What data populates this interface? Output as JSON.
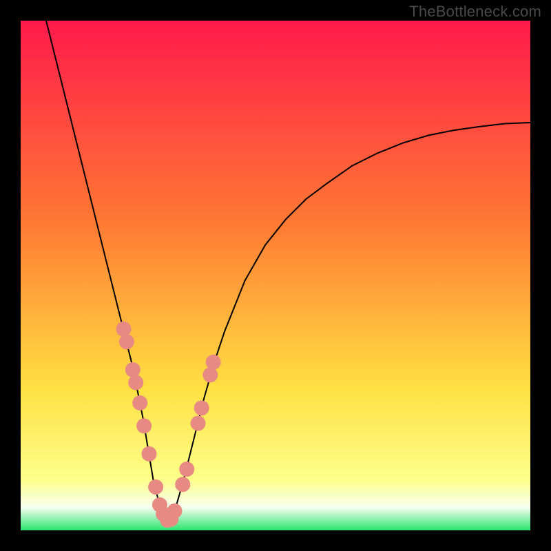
{
  "attribution": "TheBottleneck.com",
  "colors": {
    "gradient_top": "#ff1a4b",
    "gradient_mid1": "#ff7a33",
    "gradient_mid2": "#ffe042",
    "gradient_near_bottom": "#fdff8a",
    "gradient_bottom_white": "#f7fff0",
    "gradient_bottom_green": "#29e36e",
    "curve": "#000000",
    "dots": "#e88a84",
    "frame": "#000000"
  },
  "chart_data": {
    "type": "line",
    "title": "",
    "xlabel": "",
    "ylabel": "",
    "xlim": [
      0,
      100
    ],
    "ylim": [
      0,
      100
    ],
    "series": [
      {
        "name": "bottleneck-curve",
        "x": [
          5,
          8,
          10,
          12,
          14,
          16,
          18,
          20,
          22,
          24,
          25,
          26,
          27,
          28,
          29,
          30,
          32,
          34,
          36,
          38,
          40,
          44,
          48,
          52,
          56,
          60,
          65,
          70,
          75,
          80,
          85,
          90,
          95,
          100
        ],
        "values": [
          100,
          88,
          80,
          72,
          64,
          56,
          48,
          40,
          32,
          22,
          16,
          10,
          6,
          3,
          1.5,
          3,
          10,
          18,
          26,
          33,
          39,
          49,
          56,
          61,
          65,
          68,
          71.5,
          74,
          76,
          77.5,
          78.5,
          79.2,
          79.8,
          80
        ]
      }
    ],
    "left_dots": {
      "name": "left-branch-dots",
      "x": [
        20.2,
        20.8,
        22.0,
        22.6,
        23.4,
        24.2,
        25.2,
        26.5,
        27.3,
        28.0,
        28.8
      ],
      "y": [
        39.5,
        37.0,
        31.5,
        29.0,
        25.0,
        20.5,
        15.0,
        8.5,
        5.0,
        3.2,
        2.0
      ]
    },
    "right_dots": {
      "name": "right-branch-dots",
      "x": [
        29.5,
        30.2,
        31.8,
        32.6,
        34.8,
        35.5,
        37.2,
        37.8
      ],
      "y": [
        2.2,
        3.8,
        9.0,
        12.0,
        21.0,
        24.0,
        30.5,
        33.0
      ]
    }
  }
}
